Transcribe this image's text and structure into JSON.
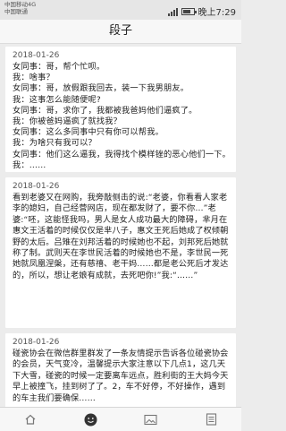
{
  "status_bar": {
    "carrier_1": "中国移动4G",
    "carrier_2": "中国联通",
    "time": "晚上7:29",
    "battery_level": 0.75
  },
  "header": {
    "title": "段子"
  },
  "feed": {
    "items": [
      {
        "date": "2018-01-26",
        "lines": [
          "女同事：哥，帮个忙呗。",
          "我：啥事？",
          "女同事：哥，放假跟我回去，装一下我男朋友。",
          "我：这事怎么能随便呢?",
          "女同事：哥，求你了，我都被我爸妈他们逼疯了。",
          "我：你被爸妈逼疯了就找我？",
          "女同事：这么多同事中只有你可以帮我。",
          "我：为啥只有我可以？",
          "女同事：他们这么逼我，我得找个模样锉的恶心他们一下。",
          "我：……"
        ]
      },
      {
        "date": "2018-01-26",
        "text": "看到老婆又在网购，我旁敲侧击的说:“老婆，你看看人家老李的媳妇，自己经营网店，现在都发财了，要不你…”老婆:“呸，这能怪我吗，男人是女人成功最大的障碍，芈月在惠文王活着的时候仅仅是芈八子，惠文王死后她成了权倾朝野的太后。吕雉在刘邦活着的时候她也不起，刘邦死后她就称了制。武则天在李世民活着的时候她也不是，李世民一死她就凤凰涅槃，还有慈禧、老干妈……都是老公死后才发达的，所以，想让老娘有成就，去死吧你!”我:“……”"
      },
      {
        "date": "2018-01-26",
        "text": "碰瓷协会在微信群里群发了一条友情提示告诉各位碰瓷协会的会员，天气变冷，温馨提示大家注意以下几点1，这几天下大雪，碰瓷的时候一定要离车远点，胜利街的王大妈今天早上被撞飞，挂到树了了。2，车不好停，不好操作，遇到的车主我们要确保……"
      }
    ]
  },
  "bottom_nav": {
    "items": [
      {
        "icon": "home-icon",
        "selected": false
      },
      {
        "icon": "smile-face-icon",
        "selected": true
      },
      {
        "icon": "image-icon",
        "selected": false
      },
      {
        "icon": "document-icon",
        "selected": false
      }
    ]
  }
}
